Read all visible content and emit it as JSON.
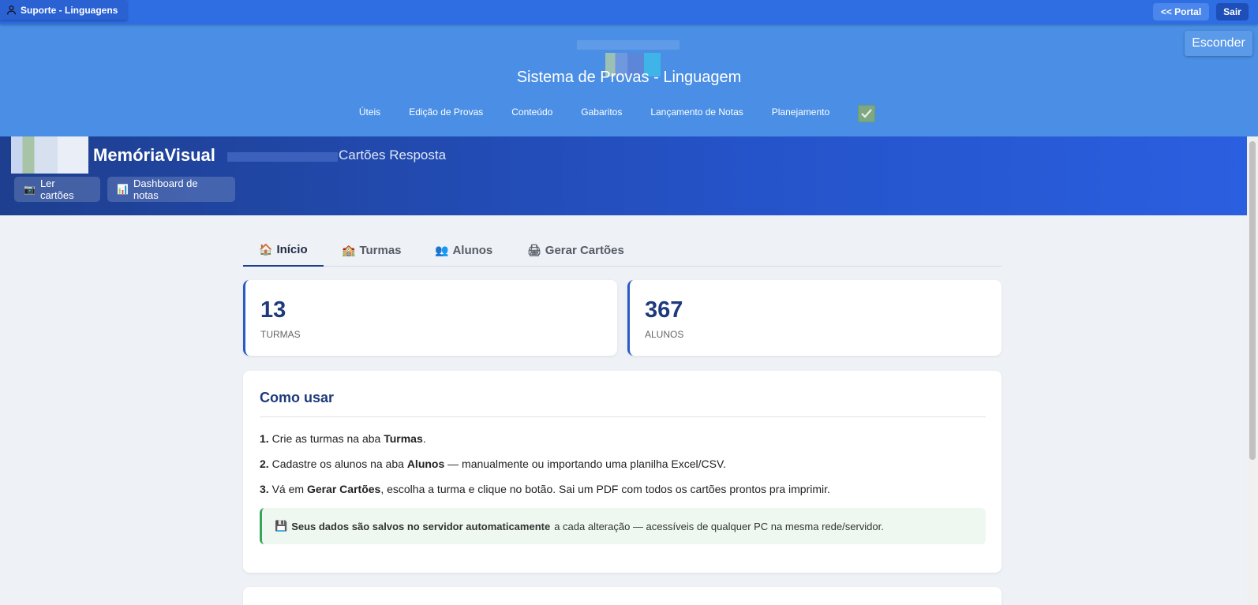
{
  "topbar": {
    "support_label": "Suporte - Linguagens",
    "portal_label": "<< Portal",
    "sair_label": "Sair"
  },
  "header": {
    "title": "Sistema de Provas - Linguagem",
    "esconder_label": "Esconder",
    "nav": [
      {
        "label": "Úteis"
      },
      {
        "label": "Edição de Provas"
      },
      {
        "label": "Conteúdo"
      },
      {
        "label": "Gabaritos"
      },
      {
        "label": "Lançamento de Notas"
      },
      {
        "label": "Planejamento"
      }
    ]
  },
  "app": {
    "name": "MemóriaVisual",
    "subtitle": "Cartões Resposta",
    "buttons": {
      "ler_label": "Ler cartões",
      "ler_icon": "📷",
      "dashboard_label": "Dashboard de notas",
      "dashboard_icon": "📊"
    }
  },
  "tabs": [
    {
      "label": "Início",
      "icon": "🏠"
    },
    {
      "label": "Turmas",
      "icon": "🏫"
    },
    {
      "label": "Alunos",
      "icon": "👥"
    },
    {
      "label": "Gerar Cartões",
      "icon": "🖨"
    }
  ],
  "stats": {
    "turmas": {
      "value": "13",
      "label": "TURMAS"
    },
    "alunos": {
      "value": "367",
      "label": "ALUNOS"
    }
  },
  "howto": {
    "title": "Como usar",
    "steps": [
      {
        "num": "1.",
        "pre": "Crie as turmas na aba",
        "bold": "Turmas",
        "post": "."
      },
      {
        "num": "2.",
        "pre": "Cadastre os alunos na aba",
        "bold": "Alunos",
        "post": "— manualmente ou importando uma planilha Excel/CSV."
      },
      {
        "num": "3.",
        "pre": "Vá em",
        "bold": "Gerar Cartões",
        "post": ", escolha a turma e clique no botão. Sai um PDF com todos os cartões prontos pra imprimir."
      }
    ],
    "note": {
      "icon": "💾",
      "bold": "Seus dados são salvos no servidor automaticamente",
      "rest": "a cada alteração — acessíveis de qualquer PC na mesma rede/servidor."
    }
  },
  "colors": {
    "topbar": "#2f6de3",
    "header": "#4a8fe5",
    "band_start": "#1e3f8f",
    "band_end": "#2a5fe0",
    "accent": "#1e3a7b",
    "note_green": "#38a55a"
  }
}
